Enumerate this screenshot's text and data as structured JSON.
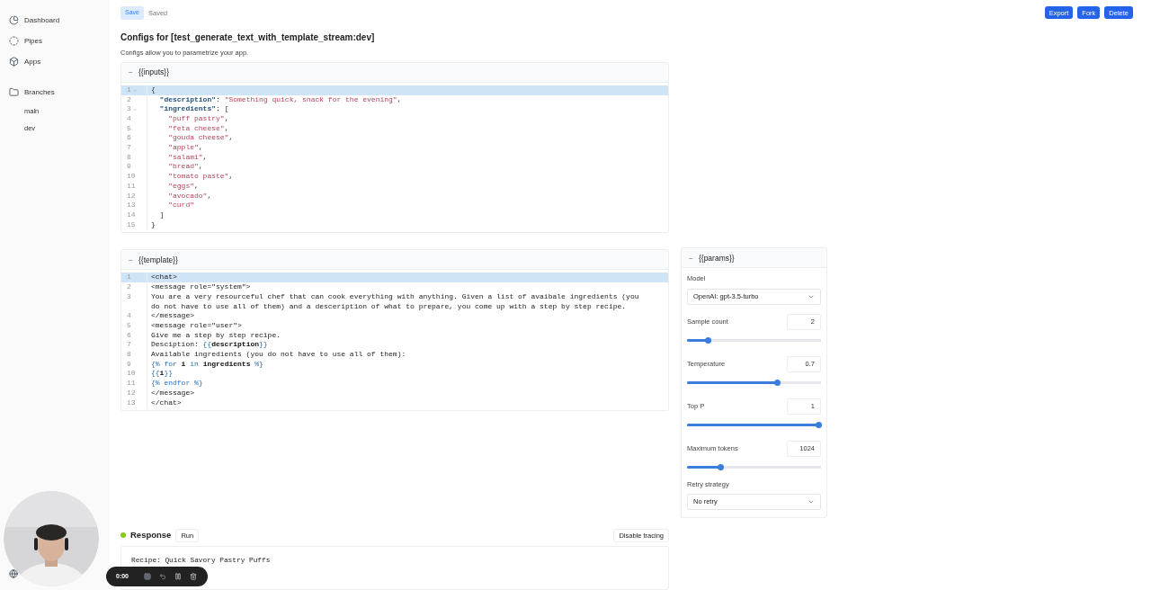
{
  "sidebar": {
    "items": [
      {
        "label": "Dashboard",
        "kind": "pie"
      },
      {
        "label": "Pipes",
        "kind": "dots"
      },
      {
        "label": "Apps",
        "kind": "box"
      }
    ],
    "branches": {
      "label": "Branches",
      "items": [
        {
          "label": "main"
        },
        {
          "label": "dev"
        }
      ]
    }
  },
  "toolbar": {
    "save": {
      "label": "Save",
      "disabled": true
    },
    "status": "Saved",
    "actions": [
      "Export",
      "Fork",
      "Delete"
    ]
  },
  "header": {
    "title": "Configs for [test_generate_text_with_template_stream:dev]",
    "subtitle": "Configs allow you to parametrize your app."
  },
  "inputs_panel": {
    "toggle": "−",
    "title": "{{inputs}}",
    "lines": [
      {
        "number": "1",
        "fold": true,
        "active": true,
        "tokens": [
          {
            "kind": "punct",
            "text": "{"
          }
        ]
      },
      {
        "number": "2",
        "fold": false,
        "active": false,
        "tokens": [
          {
            "kind": "key",
            "text": "  \"description\""
          },
          {
            "kind": "punct",
            "text": ": "
          },
          {
            "kind": "string",
            "text": "\"Something quick, snack for the evening\""
          },
          {
            "kind": "punct",
            "text": ","
          }
        ]
      },
      {
        "number": "3",
        "fold": true,
        "active": false,
        "tokens": [
          {
            "kind": "key",
            "text": "  \"ingredients\""
          },
          {
            "kind": "punct",
            "text": ": ["
          }
        ]
      },
      {
        "number": "4",
        "fold": false,
        "active": false,
        "tokens": [
          {
            "kind": "string",
            "text": "    \"puff pastry\""
          },
          {
            "kind": "punct",
            "text": ","
          }
        ]
      },
      {
        "number": "5",
        "fold": false,
        "active": false,
        "tokens": [
          {
            "kind": "string",
            "text": "    \"feta cheese\""
          },
          {
            "kind": "punct",
            "text": ","
          }
        ]
      },
      {
        "number": "6",
        "fold": false,
        "active": false,
        "tokens": [
          {
            "kind": "string",
            "text": "    \"gouda cheese\""
          },
          {
            "kind": "punct",
            "text": ","
          }
        ]
      },
      {
        "number": "7",
        "fold": false,
        "active": false,
        "tokens": [
          {
            "kind": "string",
            "text": "    \"apple\""
          },
          {
            "kind": "punct",
            "text": ","
          }
        ]
      },
      {
        "number": "8",
        "fold": false,
        "active": false,
        "tokens": [
          {
            "kind": "string",
            "text": "    \"salami\""
          },
          {
            "kind": "punct",
            "text": ","
          }
        ]
      },
      {
        "number": "9",
        "fold": false,
        "active": false,
        "tokens": [
          {
            "kind": "string",
            "text": "    \"bread\""
          },
          {
            "kind": "punct",
            "text": ","
          }
        ]
      },
      {
        "number": "10",
        "fold": false,
        "active": false,
        "tokens": [
          {
            "kind": "string",
            "text": "    \"tomato paste\""
          },
          {
            "kind": "punct",
            "text": ","
          }
        ]
      },
      {
        "number": "11",
        "fold": false,
        "active": false,
        "tokens": [
          {
            "kind": "string",
            "text": "    \"eggs\""
          },
          {
            "kind": "punct",
            "text": ","
          }
        ]
      },
      {
        "number": "12",
        "fold": false,
        "active": false,
        "tokens": [
          {
            "kind": "string",
            "text": "    \"avocado\""
          },
          {
            "kind": "punct",
            "text": ","
          }
        ]
      },
      {
        "number": "13",
        "fold": false,
        "active": false,
        "tokens": [
          {
            "kind": "string",
            "text": "    \"curd\""
          }
        ]
      },
      {
        "number": "14",
        "fold": false,
        "active": false,
        "tokens": [
          {
            "kind": "punct",
            "text": "  ]"
          }
        ]
      },
      {
        "number": "15",
        "fold": false,
        "active": false,
        "tokens": [
          {
            "kind": "punct",
            "text": "}"
          }
        ]
      }
    ]
  },
  "template_panel": {
    "toggle": "−",
    "title": "{{template}}",
    "lines": [
      {
        "number": "1",
        "fold": false,
        "active": true,
        "tokens": [
          {
            "kind": "text",
            "text": "<chat>"
          }
        ]
      },
      {
        "number": "2",
        "fold": false,
        "active": false,
        "tokens": [
          {
            "kind": "text",
            "text": "<message role=\"system\">"
          }
        ]
      },
      {
        "number": "3",
        "fold": false,
        "active": false,
        "tokens": [
          {
            "kind": "text",
            "text": "You are a very resourceful chef that can cook everything with anything. Given a list of avaibale ingredients (you do not have to use all of them) and a desceription of what to prepare, you come up with a step by step recipe."
          }
        ]
      },
      {
        "number": "4",
        "fold": false,
        "active": false,
        "tokens": [
          {
            "kind": "text",
            "text": "</message>"
          }
        ]
      },
      {
        "number": "5",
        "fold": false,
        "active": false,
        "tokens": [
          {
            "kind": "text",
            "text": "<message role=\"user\">"
          }
        ]
      },
      {
        "number": "6",
        "fold": false,
        "active": false,
        "tokens": [
          {
            "kind": "text",
            "text": "Give me a step by step recipe."
          }
        ]
      },
      {
        "number": "7",
        "fold": false,
        "active": false,
        "tokens": [
          {
            "kind": "text",
            "text": "Desciption: "
          },
          {
            "kind": "tag",
            "text": "{{"
          },
          {
            "kind": "var",
            "text": "description"
          },
          {
            "kind": "tag",
            "text": "}}"
          }
        ]
      },
      {
        "number": "8",
        "fold": false,
        "active": false,
        "tokens": [
          {
            "kind": "text",
            "text": "Available ingredients (you do not have to use all of them):"
          }
        ]
      },
      {
        "number": "9",
        "fold": false,
        "active": false,
        "tokens": [
          {
            "kind": "tag",
            "text": "{% for "
          },
          {
            "kind": "var",
            "text": "i"
          },
          {
            "kind": "tag",
            "text": " in "
          },
          {
            "kind": "var",
            "text": "ingredients"
          },
          {
            "kind": "tag",
            "text": " %}"
          }
        ]
      },
      {
        "number": "10",
        "fold": false,
        "active": false,
        "tokens": [
          {
            "kind": "tag",
            "text": "{{"
          },
          {
            "kind": "var",
            "text": "i"
          },
          {
            "kind": "tag",
            "text": "}}"
          }
        ]
      },
      {
        "number": "11",
        "fold": false,
        "active": false,
        "tokens": [
          {
            "kind": "tag",
            "text": "{% endfor %}"
          }
        ]
      },
      {
        "number": "12",
        "fold": false,
        "active": false,
        "tokens": [
          {
            "kind": "text",
            "text": "</message>"
          }
        ]
      },
      {
        "number": "13",
        "fold": false,
        "active": false,
        "tokens": [
          {
            "kind": "text",
            "text": "</chat>"
          }
        ]
      }
    ]
  },
  "params_panel": {
    "toggle": "−",
    "title": "{{params}}",
    "fields": [
      {
        "kind": "select",
        "label": "Model",
        "value": "OpenAI: gpt-3.5-turbo"
      },
      {
        "kind": "slider",
        "label": "Sample count",
        "value": "2",
        "level": 0.16
      },
      {
        "kind": "slider",
        "label": "Temperature",
        "value": "0.7",
        "level": 0.69
      },
      {
        "kind": "slider",
        "label": "Top P",
        "value": "1",
        "level": 1
      },
      {
        "kind": "slider",
        "label": "Maximum tokens",
        "value": "1024",
        "level": 0.26
      },
      {
        "kind": "select",
        "label": "Retry strategy",
        "value": "No retry"
      }
    ]
  },
  "response": {
    "title": "Response",
    "run": "Run",
    "tracing": "Disable tracing",
    "lines": [
      "Recipe: Quick Savory Pastry Puffs"
    ]
  },
  "recorder": {
    "time": "0:00"
  }
}
